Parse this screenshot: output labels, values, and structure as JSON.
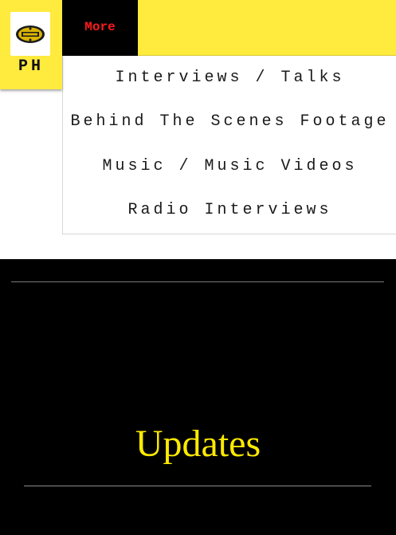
{
  "header": {
    "logo_text": "PH",
    "more_label": "More",
    "background_color": "#ffea3e",
    "more_color": "#ff1a1a"
  },
  "dropdown": {
    "items": [
      {
        "label": "Interviews / Talks"
      },
      {
        "label": "Behind The Scenes Footage"
      },
      {
        "label": "Music / Music Videos"
      },
      {
        "label": "Radio Interviews"
      }
    ]
  },
  "section": {
    "heading": "Updates",
    "heading_color": "#ffea00"
  }
}
